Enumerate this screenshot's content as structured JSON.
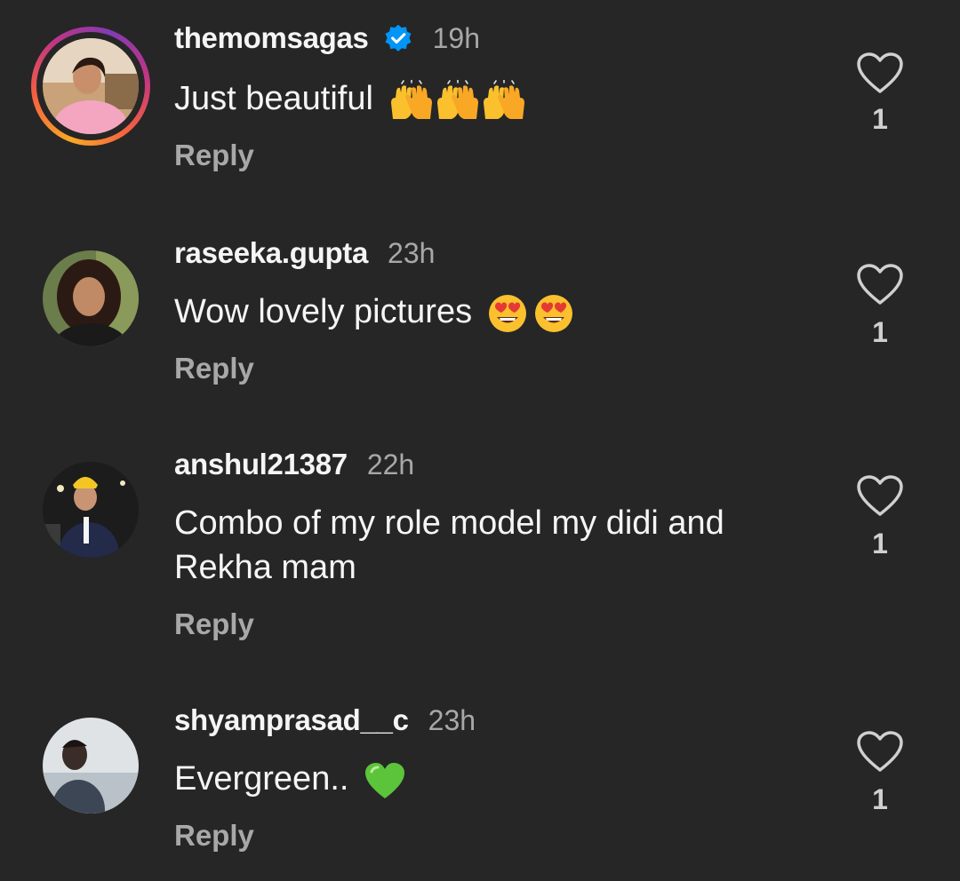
{
  "comments": [
    {
      "username": "themomsagas",
      "verified": true,
      "time": "19h",
      "text": "Just beautiful",
      "emoji": [
        "raising-hands",
        "raising-hands",
        "raising-hands"
      ],
      "reply_label": "Reply",
      "likes": "1"
    },
    {
      "username": "raseeka.gupta",
      "verified": false,
      "time": "23h",
      "text": "Wow lovely pictures",
      "emoji": [
        "heart-eyes",
        "heart-eyes"
      ],
      "reply_label": "Reply",
      "likes": "1"
    },
    {
      "username": "anshul21387",
      "verified": false,
      "time": "22h",
      "text": "Combo of my role model my didi and Rekha mam",
      "emoji": [],
      "reply_label": "Reply",
      "likes": "1"
    },
    {
      "username": "shyamprasad__c",
      "verified": false,
      "time": "23h",
      "text": "Evergreen..",
      "emoji": [
        "green-heart"
      ],
      "reply_label": "Reply",
      "likes": "1"
    }
  ],
  "colors": {
    "background": "#262626",
    "primary_text": "#f5f5f5",
    "secondary_text": "#a8a8a8",
    "verified_blue": "#0095f6"
  }
}
